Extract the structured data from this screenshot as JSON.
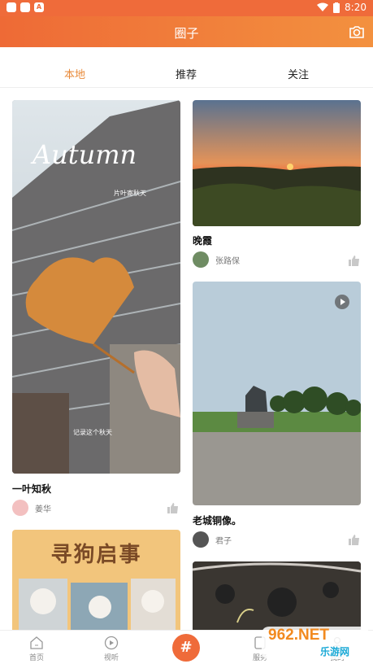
{
  "status": {
    "time": "8:20"
  },
  "header": {
    "title": "圈子"
  },
  "tabs": [
    {
      "label": "本地",
      "active": true
    },
    {
      "label": "推荐",
      "active": false
    },
    {
      "label": "关注",
      "active": false
    }
  ],
  "posts": [
    {
      "caption": "一叶知秋",
      "author": "姜华",
      "image_text_main": "Autumn",
      "image_text_sub": "片叶寄秋天",
      "image_text_bottom": "记录这个秋天"
    },
    {
      "caption": "晚霞",
      "author": "张路保"
    },
    {
      "caption": "老城铜像。",
      "author": "君子"
    },
    {
      "image_text": "寻狗启事"
    }
  ],
  "nav": [
    {
      "label": "首页"
    },
    {
      "label": "视听"
    },
    {
      "label": "#"
    },
    {
      "label": "服务"
    },
    {
      "label": "我的"
    }
  ],
  "watermark": {
    "text_main": "962.NET",
    "text_sub": "乐游网"
  },
  "colors": {
    "accent": "#ef6b3a",
    "tab_active": "#e88a3a"
  }
}
